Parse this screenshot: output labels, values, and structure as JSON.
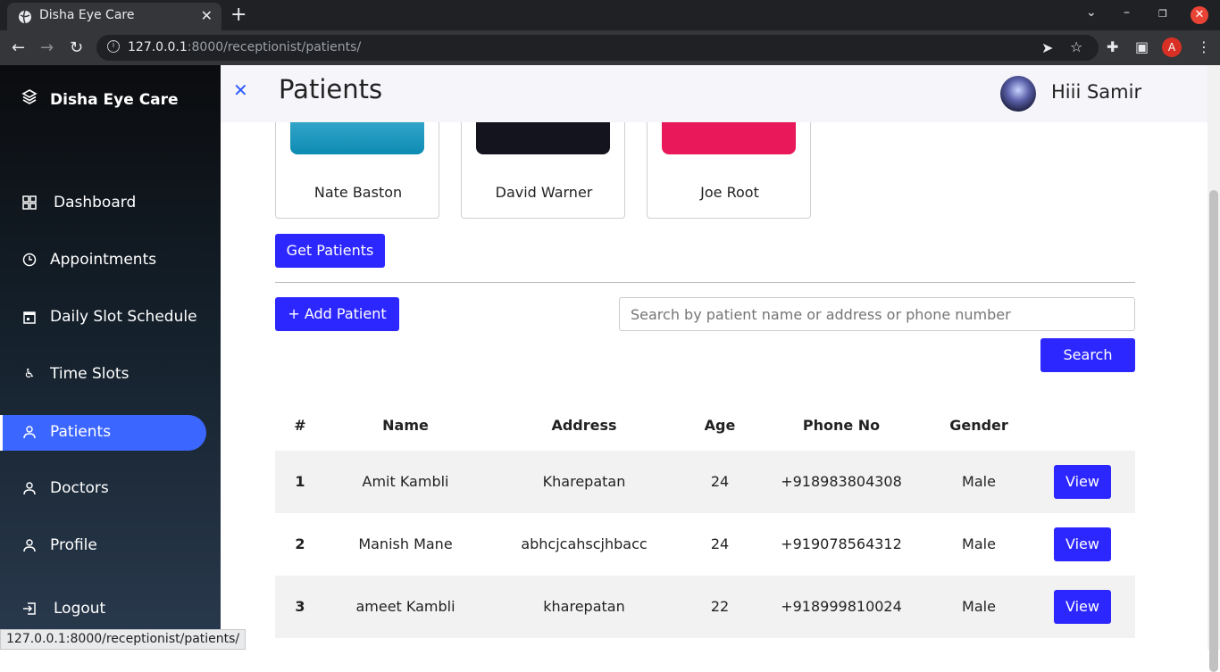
{
  "browser": {
    "tab_title": "Disha Eye Care",
    "url_host": "127.0.0.1",
    "url_rest": ":8000/receptionist/patients/",
    "status_url": "127.0.0.1:8000/receptionist/patients/",
    "profile_letter": "A"
  },
  "sidebar": {
    "brand": "Disha Eye Care",
    "items": [
      {
        "label": "Dashboard",
        "icon": "grid-icon"
      },
      {
        "label": "Appointments",
        "icon": "clock-icon"
      },
      {
        "label": "Daily Slot Schedule",
        "icon": "calendar-icon"
      },
      {
        "label": "Time Slots",
        "icon": "accessibility-icon"
      },
      {
        "label": "Patients",
        "icon": "user-icon"
      },
      {
        "label": "Doctors",
        "icon": "user-icon"
      },
      {
        "label": "Profile",
        "icon": "user-icon"
      },
      {
        "label": "Logout",
        "icon": "logout-icon"
      }
    ]
  },
  "header": {
    "title": "Patients",
    "greeting": "Hiii Samir"
  },
  "doctors": [
    {
      "name": "Nate Baston",
      "color": "#1aa3c7"
    },
    {
      "name": "David Warner",
      "color": "#14141e"
    },
    {
      "name": "Joe Root",
      "color": "#e8185a"
    }
  ],
  "actions": {
    "get_patients": "Get Patients",
    "add_patient": "+ Add Patient",
    "search_placeholder": "Search by patient name or address or phone number",
    "search": "Search"
  },
  "table": {
    "headers": [
      "#",
      "Name",
      "Address",
      "Age",
      "Phone No",
      "Gender"
    ],
    "rows": [
      {
        "num": "1",
        "name": "Amit Kambli",
        "address": "Kharepatan",
        "age": "24",
        "phone": "+918983804308",
        "gender": "Male",
        "action": "View"
      },
      {
        "num": "2",
        "name": "Manish Mane",
        "address": "abhcjcahscjhbacc",
        "age": "24",
        "phone": "+919078564312",
        "gender": "Male",
        "action": "View"
      },
      {
        "num": "3",
        "name": "ameet Kambli",
        "address": "kharepatan",
        "age": "22",
        "phone": "+918999810024",
        "gender": "Male",
        "action": "View"
      }
    ]
  },
  "colors": {
    "accent": "#2d27ff",
    "active_nav": "#3b66ff"
  }
}
